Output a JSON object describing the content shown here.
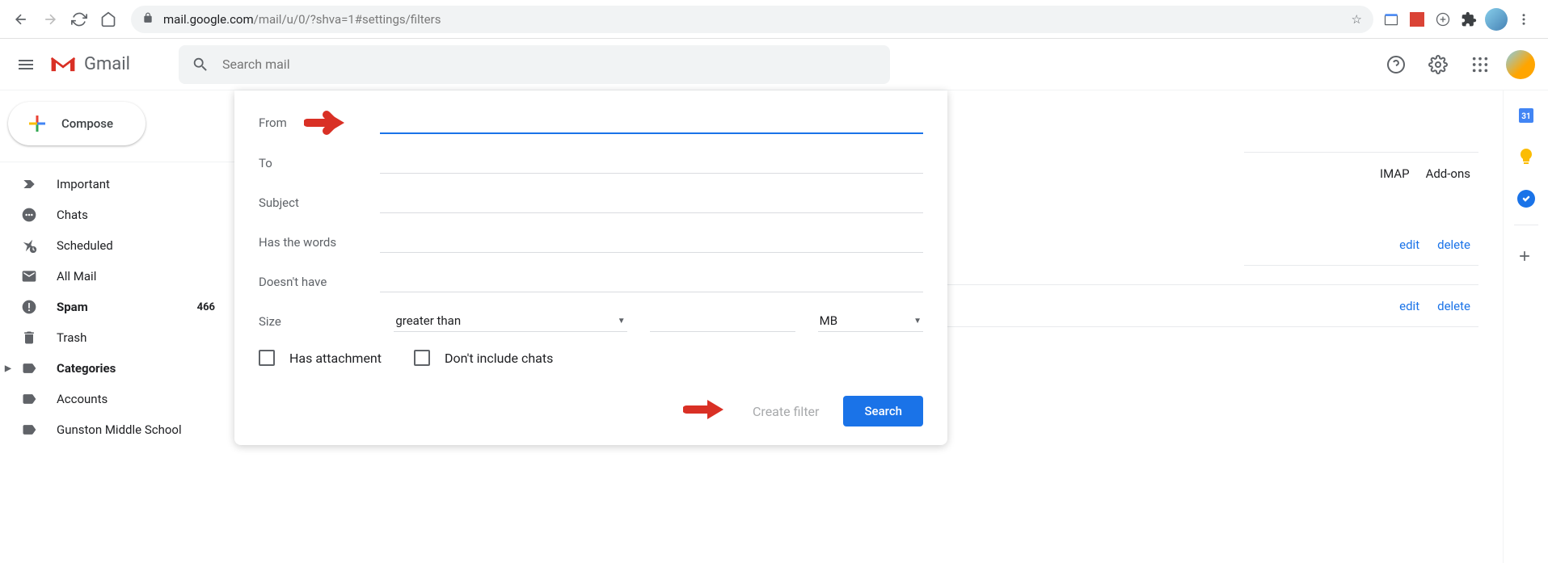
{
  "browser": {
    "url_domain": "mail.google.com",
    "url_path": "/mail/u/0/?shva=1#settings/filters"
  },
  "gmail": {
    "logo_text": "Gmail",
    "search_placeholder": "Search mail"
  },
  "compose_label": "Compose",
  "sidebar_items": [
    {
      "label": "Important",
      "bold": false,
      "icon": "important"
    },
    {
      "label": "Chats",
      "bold": false,
      "icon": "chats"
    },
    {
      "label": "Scheduled",
      "bold": false,
      "icon": "scheduled"
    },
    {
      "label": "All Mail",
      "bold": false,
      "icon": "allmail"
    },
    {
      "label": "Spam",
      "bold": true,
      "icon": "spam",
      "count": "466"
    },
    {
      "label": "Trash",
      "bold": false,
      "icon": "trash"
    },
    {
      "label": "Categories",
      "bold": true,
      "icon": "categories",
      "expandable": true
    },
    {
      "label": "Accounts",
      "bold": false,
      "icon": "label"
    },
    {
      "label": "Gunston Middle School",
      "bold": false,
      "icon": "label"
    }
  ],
  "filter_form": {
    "from": "From",
    "to": "To",
    "subject": "Subject",
    "has_words": "Has the words",
    "doesnt_have": "Doesn't have",
    "size": "Size",
    "size_op": "greater than",
    "size_unit": "MB",
    "has_attachment": "Has attachment",
    "dont_include_chats": "Don't include chats",
    "create_filter": "Create filter",
    "search": "Search"
  },
  "settings_tabs": {
    "imap": "IMAP",
    "addons": "Add-ons"
  },
  "filter_actions": {
    "edit": "edit",
    "delete": "delete"
  }
}
